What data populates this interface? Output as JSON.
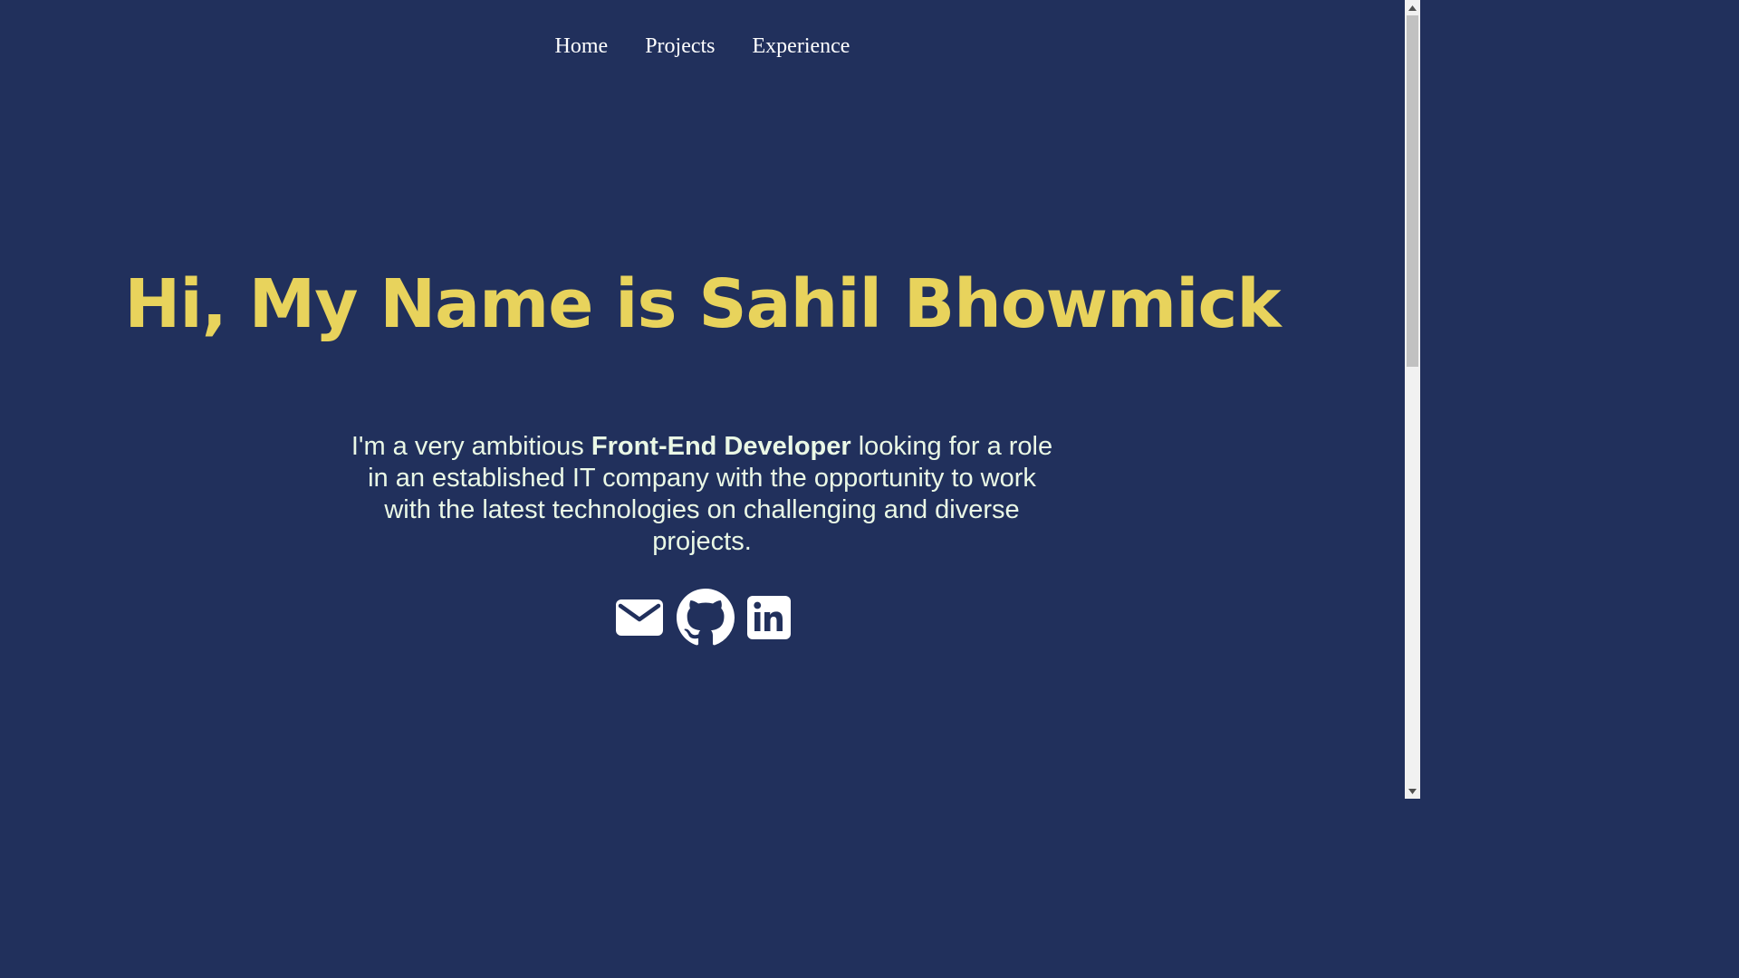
{
  "nav": {
    "items": [
      {
        "label": "Home"
      },
      {
        "label": "Projects"
      },
      {
        "label": "Experience"
      }
    ]
  },
  "hero": {
    "title": "Hi, My Name is Sahil Bhowmick",
    "intro_before": "I'm a very ambitious ",
    "intro_bold": "Front-End Developer",
    "intro_after": " looking for a role in an established IT company with the opportunity to work with the latest technologies on challenging and diverse projects."
  },
  "social": {
    "icons": [
      "mail-icon",
      "github-icon",
      "linkedin-icon"
    ]
  },
  "colors": {
    "background": "#21305c",
    "title": "#e8d35c",
    "text": "#eaf8e6",
    "nav_text": "#ffffff"
  }
}
